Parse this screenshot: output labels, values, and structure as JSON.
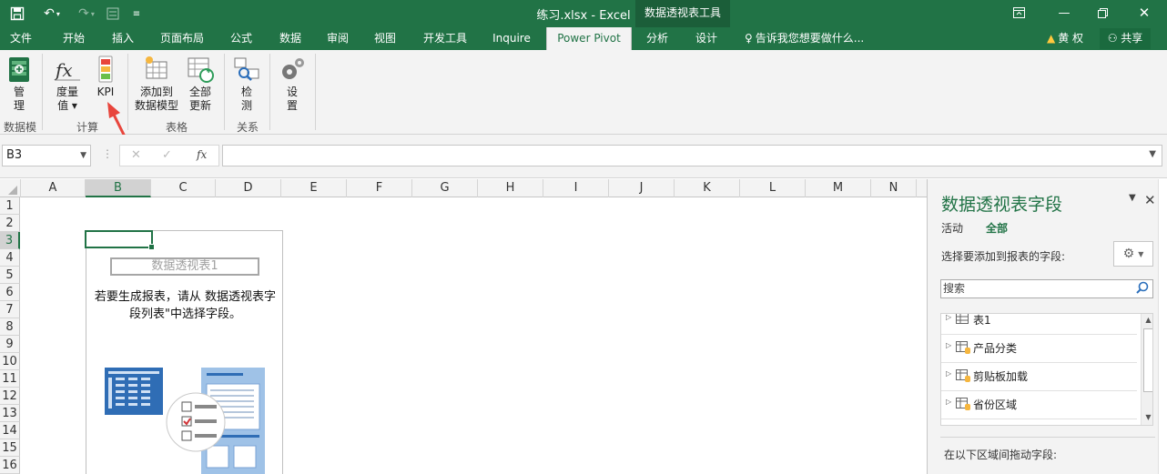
{
  "window": {
    "title": "练习.xlsx - Excel",
    "context_tools": "数据透视表工具"
  },
  "tabs": [
    {
      "label": "文件"
    },
    {
      "label": "开始"
    },
    {
      "label": "插入"
    },
    {
      "label": "页面布局"
    },
    {
      "label": "公式"
    },
    {
      "label": "数据"
    },
    {
      "label": "审阅"
    },
    {
      "label": "视图"
    },
    {
      "label": "开发工具"
    },
    {
      "label": "Inquire"
    },
    {
      "label": "Power Pivot"
    },
    {
      "label": "分析"
    },
    {
      "label": "设计"
    }
  ],
  "active_tab": "Power Pivot",
  "tell_me": "告诉我您想要做什么...",
  "user": "黄 权",
  "share": "共享",
  "ribbon": {
    "manage": "管\n理",
    "measures": "度量\n值 ▾",
    "kpi": "KPI",
    "add_to_model": "添加到\n数据模型",
    "refresh_all": "全部\n更新",
    "detect": "检\n测",
    "settings": "设\n置",
    "groups": {
      "data_model": "数据模型",
      "calculations": "计算",
      "tables": "表格",
      "relationships": "关系"
    }
  },
  "formula_bar": {
    "name_box": "B3",
    "fx": "fx",
    "value": ""
  },
  "columns": [
    "A",
    "B",
    "C",
    "D",
    "E",
    "F",
    "G",
    "H",
    "I",
    "J",
    "K",
    "L",
    "M",
    "N"
  ],
  "rows": [
    "1",
    "2",
    "3",
    "4",
    "5",
    "6",
    "7",
    "8",
    "9",
    "10",
    "11",
    "12",
    "13",
    "14",
    "15",
    "16"
  ],
  "selected_cell": {
    "col": "B",
    "row": "3"
  },
  "pivot": {
    "title": "数据透视表1",
    "hint": "若要生成报表，请从 数据透视表字段列表\"中选择字段。"
  },
  "field_pane": {
    "title": "数据透视表字段",
    "tab_active": "活动",
    "tab_all": "全部",
    "choose_label": "选择要添加到报表的字段:",
    "search_placeholder": "搜索",
    "fields": [
      "表1",
      "产品分类",
      "剪贴板加载",
      "省份区域"
    ],
    "drag_label": "在以下区域间拖动字段:"
  },
  "colors": {
    "excel_green": "#217346",
    "kpi_red": "#e8453c"
  }
}
